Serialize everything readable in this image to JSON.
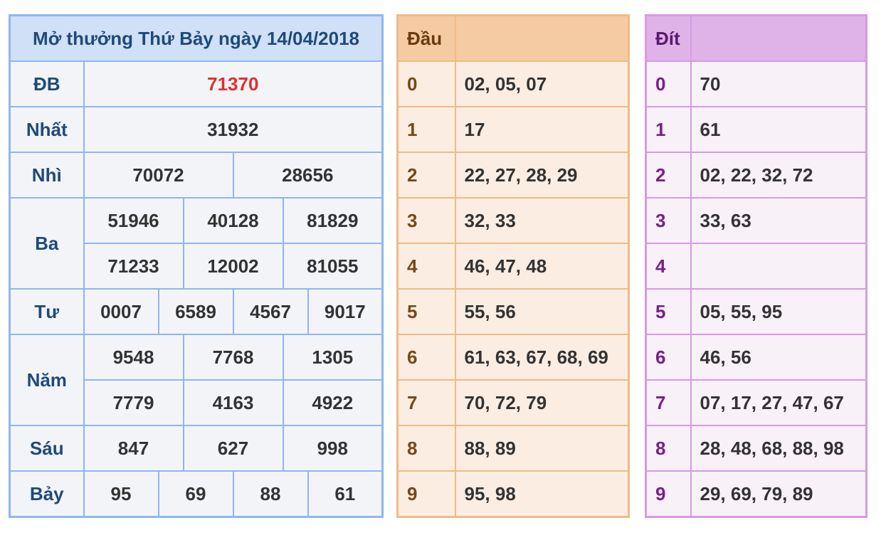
{
  "results": {
    "title": "Mở thưởng Thứ Bảy ngày 14/04/2018",
    "db": {
      "label": "ĐB",
      "values": [
        "71370"
      ]
    },
    "nhat": {
      "label": "Nhất",
      "values": [
        "31932"
      ]
    },
    "nhi": {
      "label": "Nhì",
      "values": [
        "70072",
        "28656"
      ]
    },
    "ba": {
      "label": "Ba",
      "values": [
        "51946",
        "40128",
        "81829",
        "71233",
        "12002",
        "81055"
      ]
    },
    "tu": {
      "label": "Tư",
      "values": [
        "0007",
        "6589",
        "4567",
        "9017"
      ]
    },
    "nam": {
      "label": "Năm",
      "values": [
        "9548",
        "7768",
        "1305",
        "7779",
        "4163",
        "4922"
      ]
    },
    "sau": {
      "label": "Sáu",
      "values": [
        "847",
        "627",
        "998"
      ]
    },
    "bay": {
      "label": "Bảy",
      "values": [
        "95",
        "69",
        "88",
        "61"
      ]
    }
  },
  "dau": {
    "header": "Đầu",
    "rows": [
      {
        "k": "0",
        "v": "02, 05, 07"
      },
      {
        "k": "1",
        "v": "17"
      },
      {
        "k": "2",
        "v": "22, 27, 28, 29"
      },
      {
        "k": "3",
        "v": "32, 33"
      },
      {
        "k": "4",
        "v": "46, 47, 48"
      },
      {
        "k": "5",
        "v": "55, 56"
      },
      {
        "k": "6",
        "v": "61, 63, 67, 68, 69"
      },
      {
        "k": "7",
        "v": "70, 72, 79"
      },
      {
        "k": "8",
        "v": "88, 89"
      },
      {
        "k": "9",
        "v": "95, 98"
      }
    ]
  },
  "dit": {
    "header": "Đít",
    "rows": [
      {
        "k": "0",
        "v": "70"
      },
      {
        "k": "1",
        "v": "61"
      },
      {
        "k": "2",
        "v": "02, 22, 32, 72"
      },
      {
        "k": "3",
        "v": "33, 63"
      },
      {
        "k": "4",
        "v": ""
      },
      {
        "k": "5",
        "v": "05, 55, 95"
      },
      {
        "k": "6",
        "v": "46, 56"
      },
      {
        "k": "7",
        "v": "07, 17, 27, 47, 67"
      },
      {
        "k": "8",
        "v": "28, 48, 68, 88, 98"
      },
      {
        "k": "9",
        "v": "29, 69, 79, 89"
      }
    ]
  },
  "colors": {
    "results_border": "#8fb6ee",
    "special_prize": "#e0302b",
    "dau_border": "#efbb86",
    "dit_border": "#d79ae2"
  }
}
